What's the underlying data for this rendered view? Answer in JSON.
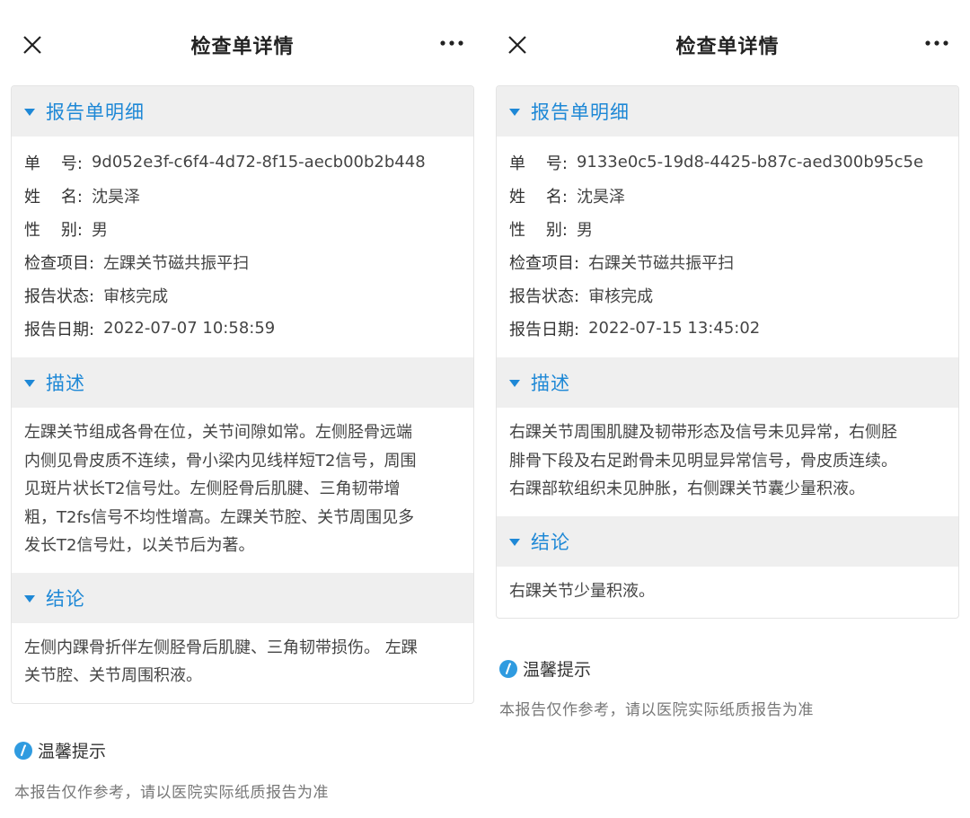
{
  "panels": [
    {
      "header": {
        "title": "检查单详情"
      },
      "report": {
        "title": "报告单明细",
        "fields": [
          {
            "label": "单    号:",
            "value": "9d052e3f-c6f4-4d72-8f15-aecb00b2b448"
          },
          {
            "label": "姓    名:",
            "value": "沈昊泽"
          },
          {
            "label": "性    别:",
            "value": "男"
          },
          {
            "label": "检查项目:",
            "value": "左踝关节磁共振平扫"
          },
          {
            "label": "报告状态:",
            "value": "审核完成"
          },
          {
            "label": "报告日期:",
            "value": "2022-07-07 10:58:59"
          }
        ]
      },
      "description": {
        "title": "描述",
        "lines": [
          "左踝关节组成各骨在位，关节间隙如常。左侧胫骨远端",
          "内侧见骨皮质不连续，骨小梁内见线样短T2信号，周围",
          "见斑片状长T2信号灶。左侧胫骨后肌腱、三角韧带增",
          "粗，T2fs信号不均性增高。左踝关节腔、关节周围见多",
          "发长T2信号灶，以关节后为著。"
        ]
      },
      "conclusion": {
        "title": "结论",
        "lines": [
          "左侧内踝骨折伴左侧胫骨后肌腱、三角韧带损伤。 左踝",
          "关节腔、关节周围积液。"
        ]
      },
      "tip": {
        "title": "温馨提示",
        "note": "本报告仅作参考，请以医院实际纸质报告为准"
      }
    },
    {
      "header": {
        "title": "检查单详情"
      },
      "report": {
        "title": "报告单明细",
        "fields": [
          {
            "label": "单    号:",
            "value": "9133e0c5-19d8-4425-b87c-aed300b95c5e"
          },
          {
            "label": "姓    名:",
            "value": "沈昊泽"
          },
          {
            "label": "性    别:",
            "value": "男"
          },
          {
            "label": "检查项目:",
            "value": "右踝关节磁共振平扫"
          },
          {
            "label": "报告状态:",
            "value": "审核完成"
          },
          {
            "label": "报告日期:",
            "value": "2022-07-15 13:45:02"
          }
        ]
      },
      "description": {
        "title": "描述",
        "lines": [
          "右踝关节周围肌腱及韧带形态及信号未见异常，右侧胫",
          "腓骨下段及右足跗骨未见明显异常信号，骨皮质连续。",
          "右踝部软组织未见肿胀，右侧踝关节囊少量积液。"
        ]
      },
      "conclusion": {
        "title": "结论",
        "lines": [
          "右踝关节少量积液。"
        ]
      },
      "tip": {
        "title": "温馨提示",
        "note": "本报告仅作参考，请以医院实际纸质报告为准"
      }
    }
  ],
  "colors": {
    "accent": "#1e88d6",
    "section_bg": "#efefef",
    "border": "#e4e4e4"
  },
  "icons": {
    "close": "close-icon",
    "more": "more-icon",
    "caret": "caret-down-icon",
    "tip": "info-icon"
  }
}
